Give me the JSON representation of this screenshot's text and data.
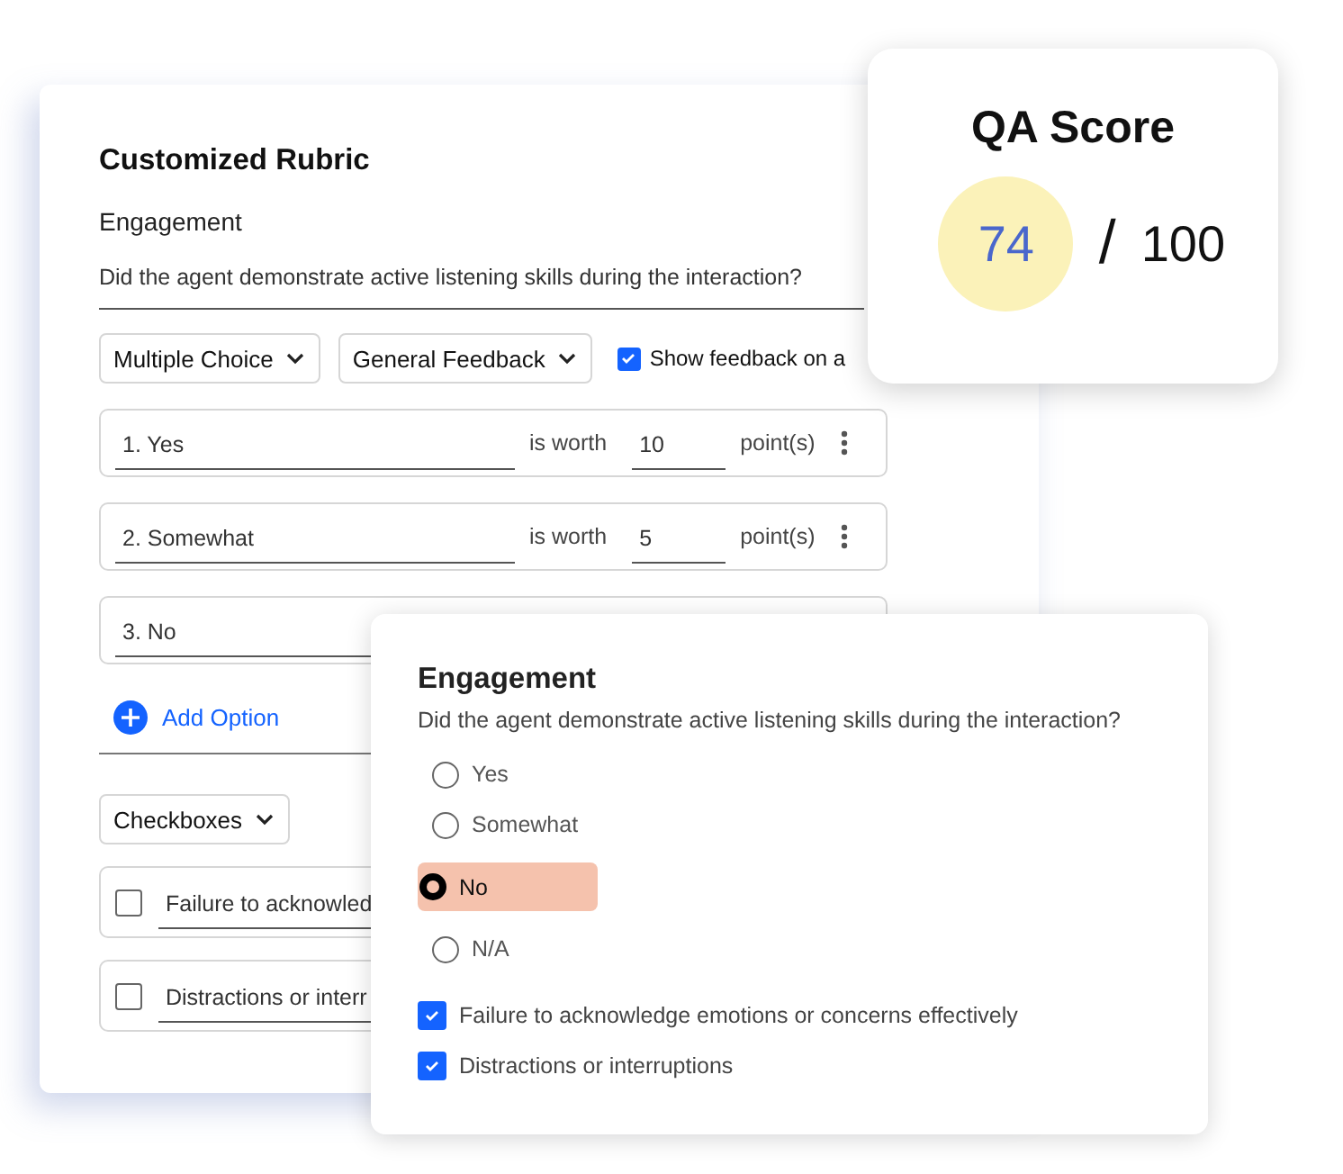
{
  "rubric": {
    "title": "Customized Rubric",
    "section": "Engagement",
    "question": "Did the agent demonstrate active listening skills during the interaction?",
    "question_type": "Multiple Choice",
    "feedback_type": "General Feedback",
    "show_feedback": {
      "label": "Show feedback on a",
      "checked": true
    },
    "options": [
      {
        "label": "1. Yes",
        "worth_label": "is worth",
        "points": "10",
        "unit": "point(s)"
      },
      {
        "label": "2. Somewhat",
        "worth_label": "is worth",
        "points": "5",
        "unit": "point(s)"
      },
      {
        "label": "3. No"
      }
    ],
    "add_option": "Add Option",
    "checkbox_type": "Checkboxes",
    "checkbox_items": [
      {
        "label": "Failure to acknowled",
        "checked": false
      },
      {
        "label": "Distractions or interr",
        "checked": false
      }
    ]
  },
  "score_card": {
    "title": "QA Score",
    "score": "74",
    "separator": "/",
    "total": "100"
  },
  "preview": {
    "section": "Engagement",
    "question": "Did the agent demonstrate active listening skills during the interaction?",
    "choices": [
      {
        "label": "Yes",
        "selected": false
      },
      {
        "label": "Somewhat",
        "selected": false
      },
      {
        "label": "No",
        "selected": true
      },
      {
        "label": "N/A",
        "selected": false
      }
    ],
    "criteria": [
      {
        "label": "Failure to acknowledge emotions or concerns effectively",
        "checked": true
      },
      {
        "label": "Distractions or interruptions",
        "checked": true
      }
    ]
  }
}
